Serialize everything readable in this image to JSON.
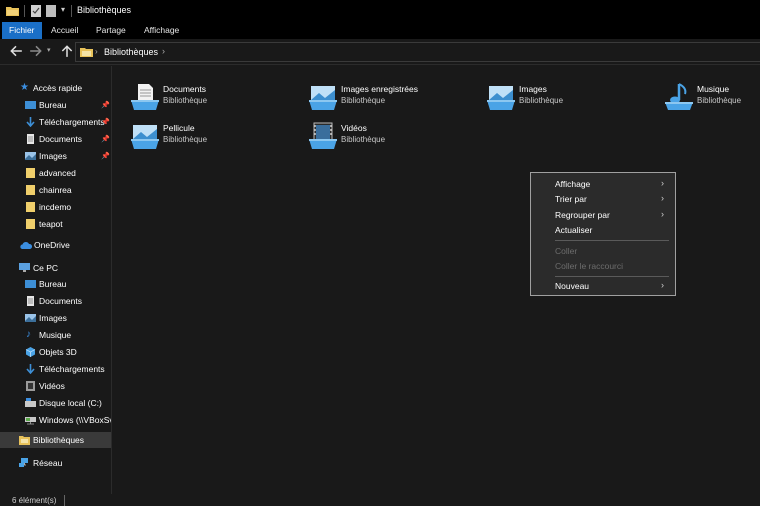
{
  "window": {
    "title": "Bibliothèques"
  },
  "ribbon": {
    "tabs": [
      "Fichier",
      "Accueil",
      "Partage",
      "Affichage"
    ]
  },
  "address": {
    "path": "Bibliothèques"
  },
  "sidebar": {
    "quick_access": "Accès rapide",
    "quick_items": [
      "Bureau",
      "Téléchargements",
      "Documents",
      "Images",
      "advanced",
      "chainrea",
      "incdemo",
      "teapot"
    ],
    "onedrive": "OneDrive",
    "this_pc": "Ce PC",
    "pc_items": [
      "Bureau",
      "Documents",
      "Images",
      "Musique",
      "Objets 3D",
      "Téléchargements",
      "Vidéos",
      "Disque local (C:)",
      "Windows (\\\\VBoxSv"
    ],
    "libraries": "Bibliothèques",
    "network": "Réseau"
  },
  "libraries": [
    {
      "name": "Documents",
      "type": "Bibliothèque",
      "icon": "documents-library-icon"
    },
    {
      "name": "Images enregistrées",
      "type": "Bibliothèque",
      "icon": "saved-pictures-library-icon"
    },
    {
      "name": "Images",
      "type": "Bibliothèque",
      "icon": "pictures-library-icon"
    },
    {
      "name": "Musique",
      "type": "Bibliothèque",
      "icon": "music-library-icon"
    },
    {
      "name": "Pellicule",
      "type": "Bibliothèque",
      "icon": "camera-roll-library-icon"
    },
    {
      "name": "Vidéos",
      "type": "Bibliothèque",
      "icon": "videos-library-icon"
    }
  ],
  "context_menu": {
    "items": [
      {
        "label": "Affichage"
      },
      {
        "label": "Trier par"
      },
      {
        "label": "Regrouper par"
      },
      {
        "label": "Actualiser"
      },
      {
        "label": "Coller"
      },
      {
        "label": "Coller le raccourci"
      },
      {
        "label": "Nouveau"
      }
    ]
  },
  "status": {
    "count": "6 élément(s)"
  },
  "colors": {
    "accent": "#1a6fc7",
    "background": "#191919",
    "menu_bg": "#2b2b2b",
    "disabled_text": "#6d6d6d"
  }
}
